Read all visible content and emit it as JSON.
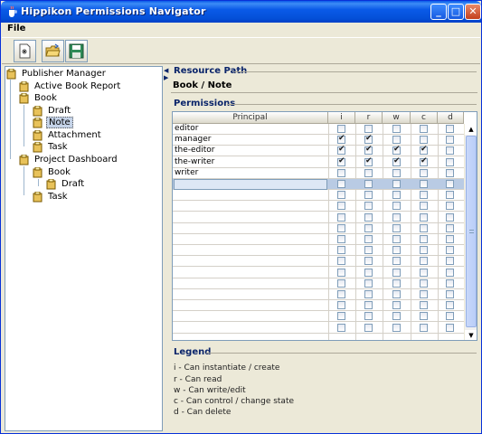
{
  "window": {
    "title": "Hippikon Permissions Navigator"
  },
  "menu": {
    "file": "File"
  },
  "toolbar": {
    "buttons": [
      {
        "icon": "new-document-icon"
      },
      {
        "icon": "open-folder-icon"
      },
      {
        "icon": "save-disk-icon"
      }
    ]
  },
  "tree": {
    "items": [
      {
        "label": "Publisher Manager",
        "level": 0
      },
      {
        "label": "Active Book Report",
        "level": 1
      },
      {
        "label": "Book",
        "level": 1
      },
      {
        "label": "Draft",
        "level": 2
      },
      {
        "label": "Note",
        "level": 2,
        "selected": true
      },
      {
        "label": "Attachment",
        "level": 2
      },
      {
        "label": "Task",
        "level": 2
      },
      {
        "label": "Project Dashboard",
        "level": 1
      },
      {
        "label": "Book",
        "level": 2
      },
      {
        "label": "Draft",
        "level": 3
      },
      {
        "label": "Task",
        "level": 2
      }
    ]
  },
  "resource": {
    "section_title": "Resource Path",
    "path": "Book / Note"
  },
  "permissions": {
    "section_title": "Permissions",
    "columns": [
      "Principal",
      "i",
      "r",
      "w",
      "c",
      "d"
    ],
    "rows": [
      {
        "principal": "editor",
        "i": false,
        "r": false,
        "w": false,
        "c": false,
        "d": false
      },
      {
        "principal": "manager",
        "i": true,
        "r": true,
        "w": false,
        "c": false,
        "d": false
      },
      {
        "principal": "the-editor",
        "i": true,
        "r": true,
        "w": true,
        "c": true,
        "d": false
      },
      {
        "principal": "the-writer",
        "i": true,
        "r": true,
        "w": true,
        "c": true,
        "d": false
      },
      {
        "principal": "writer",
        "i": false,
        "r": false,
        "w": false,
        "c": false,
        "d": false
      }
    ]
  },
  "legend": {
    "section_title": "Legend",
    "lines": [
      "i - Can instantiate / create",
      "r - Can read",
      "w - Can write/edit",
      "c - Can control / change state",
      "d - Can delete"
    ]
  }
}
